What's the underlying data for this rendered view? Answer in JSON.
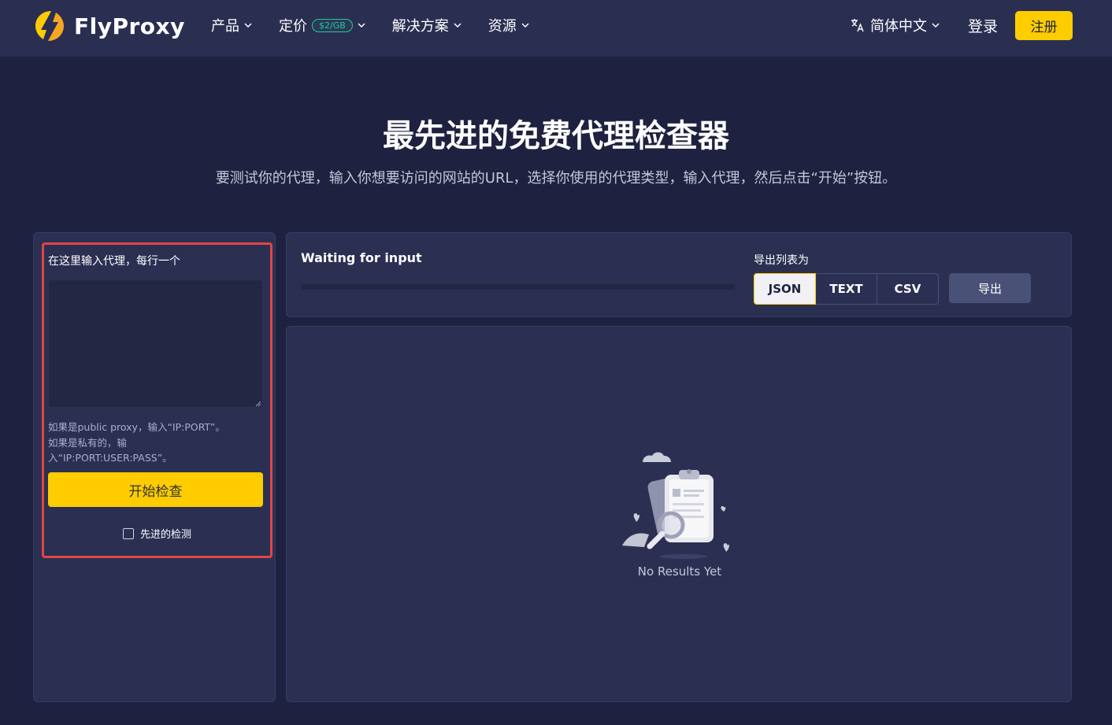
{
  "brand": {
    "name": "FlyProxy",
    "accent": "#ffcc00"
  },
  "nav": {
    "items": [
      {
        "label": "产品"
      },
      {
        "label": "定价",
        "badge": "$2/GB"
      },
      {
        "label": "解决方案"
      },
      {
        "label": "资源"
      }
    ],
    "language": "简体中文",
    "login": "登录",
    "signup": "注册"
  },
  "hero": {
    "title": "最先进的免费代理检查器",
    "subtitle": "要测试你的代理，输入你想要访问的网站的URL，选择你使用的代理类型，输入代理，然后点击“开始”按钮。"
  },
  "input_panel": {
    "label": "在这里输入代理，每行一个",
    "textarea_value": "",
    "hint": "如果是public proxy，输入“IP:PORT”。如果是私有的，输入“IP:PORT:USER:PASS”。",
    "start_button": "开始检查",
    "advanced_label": "先进的检测",
    "advanced_checked": false
  },
  "status_panel": {
    "status": "Waiting for input",
    "progress": 0,
    "export_label": "导出列表为",
    "formats": [
      "JSON",
      "TEXT",
      "CSV"
    ],
    "selected_format": "JSON",
    "export_button": "导出"
  },
  "results": {
    "empty_text": "No Results Yet"
  }
}
